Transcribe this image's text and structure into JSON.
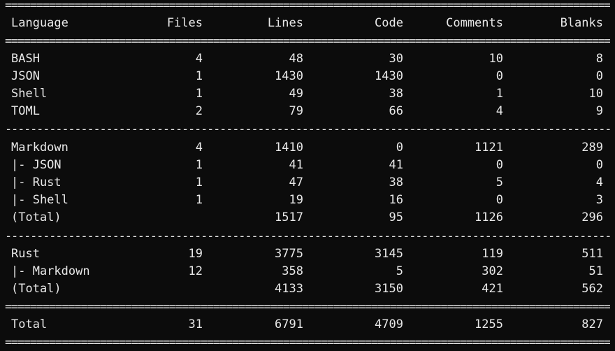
{
  "separators": {
    "double": "====================================================================================================",
    "single": "----------------------------------------------------------------------------------------------------"
  },
  "header": [
    "Language",
    "Files",
    "Lines",
    "Code",
    "Comments",
    "Blanks"
  ],
  "group1": [
    [
      "BASH",
      "4",
      "48",
      "30",
      "10",
      "8"
    ],
    [
      "JSON",
      "1",
      "1430",
      "1430",
      "0",
      "0"
    ],
    [
      "Shell",
      "1",
      "49",
      "38",
      "1",
      "10"
    ],
    [
      "TOML",
      "2",
      "79",
      "66",
      "4",
      "9"
    ]
  ],
  "group2": [
    [
      "Markdown",
      "4",
      "1410",
      "0",
      "1121",
      "289"
    ],
    [
      "|- JSON",
      "1",
      "41",
      "41",
      "0",
      "0"
    ],
    [
      "|- Rust",
      "1",
      "47",
      "38",
      "5",
      "4"
    ],
    [
      "|- Shell",
      "1",
      "19",
      "16",
      "0",
      "3"
    ],
    [
      "(Total)",
      "",
      "1517",
      "95",
      "1126",
      "296"
    ]
  ],
  "group3": [
    [
      "Rust",
      "19",
      "3775",
      "3145",
      "119",
      "511"
    ],
    [
      "|- Markdown",
      "12",
      "358",
      "5",
      "302",
      "51"
    ],
    [
      "(Total)",
      "",
      "4133",
      "3150",
      "421",
      "562"
    ]
  ],
  "total": [
    "Total",
    "31",
    "6791",
    "4709",
    "1255",
    "827"
  ]
}
